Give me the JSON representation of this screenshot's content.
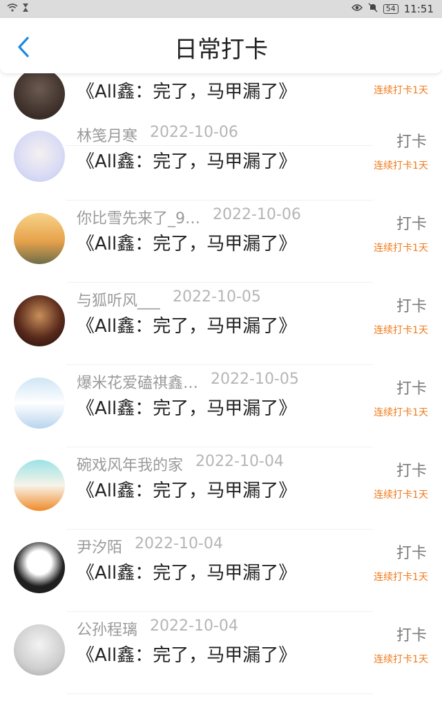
{
  "status_bar": {
    "time": "11:51",
    "battery": "54",
    "left_icons": [
      "wifi-icon",
      "hourglass-icon"
    ],
    "right_icons": [
      "eye-icon",
      "mute-icon",
      "battery-icon"
    ]
  },
  "header": {
    "title": "日常打卡",
    "back_icon": "chevron-left-icon"
  },
  "colors": {
    "accent": "#1e88e5",
    "streak": "#f07a1a",
    "muted_text": "#9a9a9a"
  },
  "entries": [
    {
      "name": "",
      "date": "",
      "content": "《All鑫：完了，马甲漏了》",
      "action": "",
      "streak": "连续打卡1天"
    },
    {
      "name": "林笺月寒",
      "date": "2022-10-06",
      "content": "《All鑫：完了，马甲漏了》",
      "action": "打卡",
      "streak": "连续打卡1天"
    },
    {
      "name": "你比雪先来了_9…",
      "date": "2022-10-06",
      "content": "《All鑫：完了，马甲漏了》",
      "action": "打卡",
      "streak": "连续打卡1天"
    },
    {
      "name": "与狐听风___",
      "date": "2022-10-05",
      "content": "《All鑫：完了，马甲漏了》",
      "action": "打卡",
      "streak": "连续打卡1天"
    },
    {
      "name": "爆米花爱磕祺鑫…",
      "date": "2022-10-05",
      "content": "《All鑫：完了，马甲漏了》",
      "action": "打卡",
      "streak": "连续打卡1天"
    },
    {
      "name": "碗戏风年我的家",
      "date": "2022-10-04",
      "content": "《All鑫：完了，马甲漏了》",
      "action": "打卡",
      "streak": "连续打卡1天"
    },
    {
      "name": "尹汐陌",
      "date": "2022-10-04",
      "content": "《All鑫：完了，马甲漏了》",
      "action": "打卡",
      "streak": "连续打卡1天"
    },
    {
      "name": "公孙程璃",
      "date": "2022-10-04",
      "content": "《All鑫：完了，马甲漏了》",
      "action": "打卡",
      "streak": "连续打卡1天"
    }
  ]
}
